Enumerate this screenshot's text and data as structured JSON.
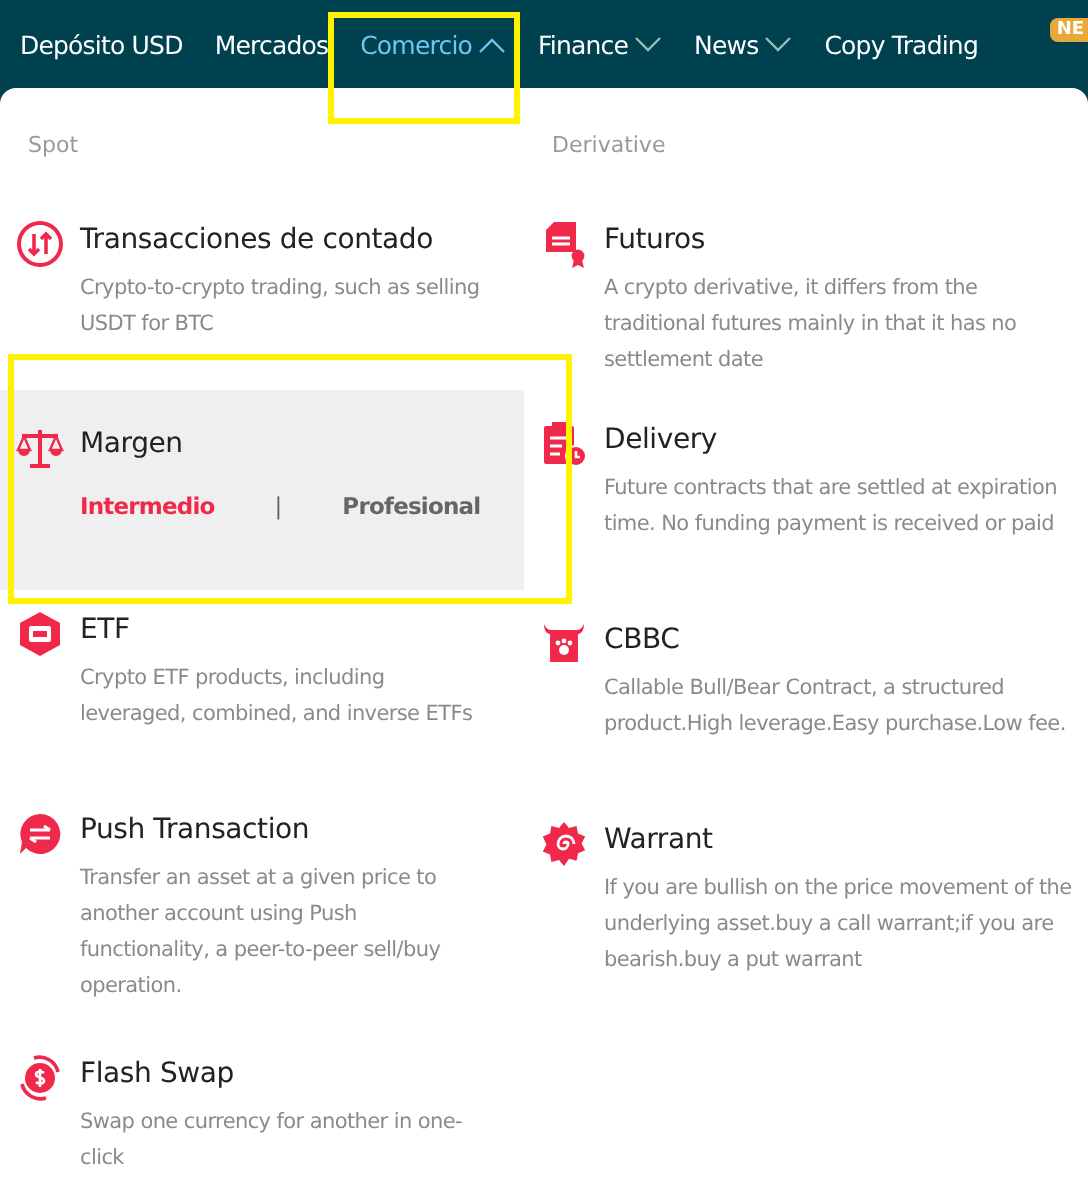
{
  "nav": {
    "items": [
      {
        "label": "Depósito USD",
        "selected": false,
        "dropdown": false
      },
      {
        "label": "Mercados",
        "selected": false,
        "dropdown": false
      },
      {
        "label": "Comercio",
        "selected": true,
        "dropdown": true,
        "expanded": true,
        "annotated": true
      },
      {
        "label": "Finance",
        "selected": false,
        "dropdown": true,
        "expanded": false
      },
      {
        "label": "News",
        "selected": false,
        "dropdown": true,
        "expanded": false
      },
      {
        "label": "Copy Trading",
        "selected": false,
        "dropdown": false,
        "badge": "NE"
      }
    ]
  },
  "menu": {
    "columns": [
      {
        "heading": "Spot",
        "items": [
          {
            "title": "Transacciones de contado",
            "description": "Crypto-to-crypto trading, such as selling USDT for BTC",
            "highlighted": false
          },
          {
            "title": "Margen",
            "highlighted": true,
            "annotated": true,
            "links": [
              {
                "label": "Intermedio",
                "selected": true
              },
              {
                "label": "Profesional",
                "selected": false
              }
            ],
            "separator": "|"
          },
          {
            "title": "ETF",
            "description": "Crypto ETF products, including leveraged, combined, and inverse ETFs",
            "highlighted": false
          },
          {
            "title": "Push Transaction",
            "description": "Transfer an asset at a given price to another account using Push functionality, a peer-to-peer sell/buy operation.",
            "highlighted": false
          },
          {
            "title": "Flash Swap",
            "description": "Swap one currency for another in one-click",
            "highlighted": false
          }
        ]
      },
      {
        "heading": "Derivative",
        "items": [
          {
            "title": "Futuros",
            "description": "A crypto derivative, it differs from the traditional futures mainly in that it has no settlement date",
            "highlighted": false
          },
          {
            "title": "Delivery",
            "description": "Future contracts that are settled at expiration time. No funding payment is received or paid",
            "highlighted": false
          },
          {
            "title": "CBBC",
            "description": "Callable Bull/Bear Contract, a structured product.High leverage.Easy purchase.Low fee.",
            "highlighted": false
          },
          {
            "title": "Warrant",
            "description": "If you are bullish on the price movement of the underlying asset.buy a call warrant;if you are bearish.buy a put warrant",
            "highlighted": false
          }
        ]
      }
    ]
  }
}
